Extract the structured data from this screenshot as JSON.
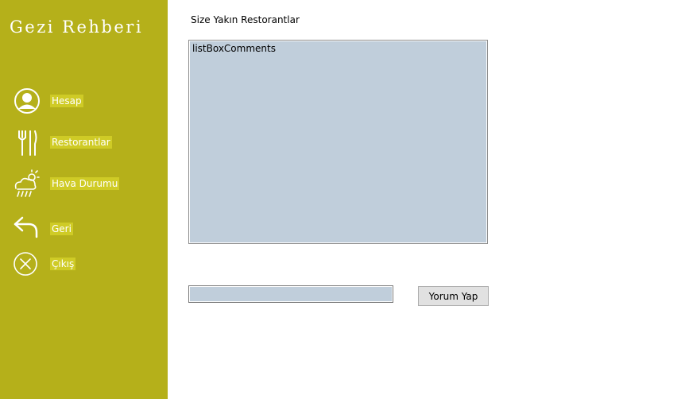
{
  "app": {
    "title": "Gezi Rehberi"
  },
  "sidebar": {
    "items": [
      {
        "label": "Hesap",
        "icon": "user-circle-icon"
      },
      {
        "label": "Restorantlar",
        "icon": "fork-knife-icon"
      },
      {
        "label": "Hava Durumu",
        "icon": "weather-rain-icon"
      },
      {
        "label": "Geri",
        "icon": "back-arrow-icon"
      },
      {
        "label": "Çıkış",
        "icon": "close-circle-icon"
      }
    ]
  },
  "main": {
    "heading": "Size Yakın Restorantlar",
    "listbox": {
      "text": "listBoxComments"
    },
    "comment_input": {
      "value": "",
      "placeholder": ""
    },
    "comment_button": "Yorum Yap"
  },
  "colors": {
    "sidebar": "#b5b01a",
    "label_highlight": "#cfcb26",
    "listbox": "#c0cedb"
  }
}
